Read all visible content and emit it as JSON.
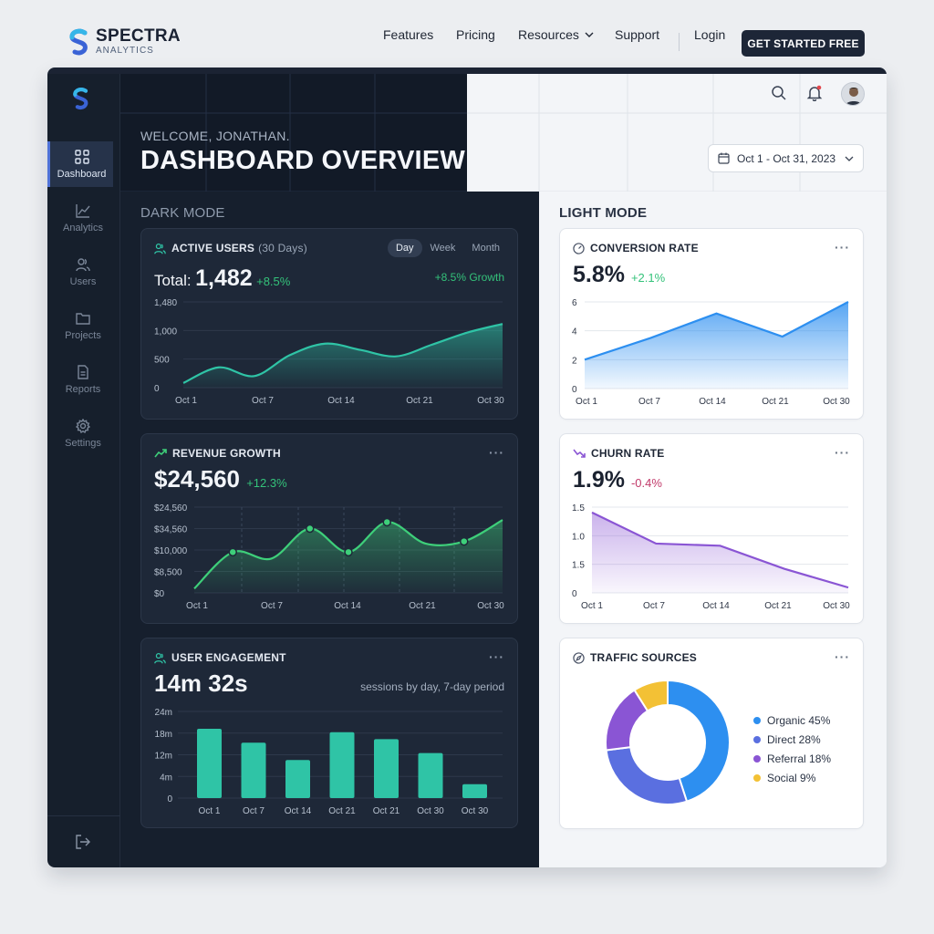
{
  "brand": {
    "name": "SPECTRA",
    "sub": "ANALYTICS"
  },
  "nav": {
    "links": [
      "Features",
      "Pricing",
      "Resources",
      "Support"
    ],
    "login": "Login",
    "cta": "GET STARTED FREE"
  },
  "sidebar": {
    "items": [
      {
        "label": "Dashboard",
        "icon": "grid-icon",
        "active": true
      },
      {
        "label": "Analytics",
        "icon": "trend-icon"
      },
      {
        "label": "Users",
        "icon": "users-icon"
      },
      {
        "label": "Projects",
        "icon": "folder-icon"
      },
      {
        "label": "Reports",
        "icon": "document-icon"
      },
      {
        "label": "Settings",
        "icon": "gear-icon"
      }
    ]
  },
  "header": {
    "welcome": "WELCOME, JONATHAN.",
    "title": "DASHBOARD OVERVIEW",
    "date_range": "Oct 1 - Oct 31, 2023"
  },
  "sections": {
    "dark": "DARK MODE",
    "light": "LIGHT MODE"
  },
  "cards": {
    "active_users": {
      "title": "ACTIVE USERS",
      "subtitle": "(30 Days)",
      "total_label": "Total:",
      "total": "1,482",
      "delta": "+8.5%",
      "growth": "+8.5% Growth",
      "segments": [
        "Day",
        "Week",
        "Month"
      ],
      "selected_segment": "Day"
    },
    "revenue": {
      "title": "REVENUE GROWTH",
      "value": "$24,560",
      "delta": "+12.3%"
    },
    "engagement": {
      "title": "USER ENGAGEMENT",
      "value": "14m 32s",
      "note": "sessions by day, 7-day period"
    },
    "conversion": {
      "title": "CONVERSION RATE",
      "value": "5.8%",
      "delta": "+2.1%"
    },
    "churn": {
      "title": "CHURN RATE",
      "value": "1.9%",
      "delta": "-0.4%"
    },
    "traffic": {
      "title": "TRAFFIC SOURCES"
    }
  },
  "colors": {
    "teal": "#2fc4a6",
    "green": "#3ecf7a",
    "blue": "#2d8ff0",
    "purple": "#8a55d4",
    "indigo": "#5a6fe0",
    "yellow": "#f3c135"
  },
  "chart_data": [
    {
      "id": "active_users",
      "type": "area",
      "x": [
        "Oct 1",
        "Oct 4",
        "Oct 7",
        "Oct 10",
        "Oct 12",
        "Oct 14",
        "Oct 18",
        "Oct 21",
        "Oct 25",
        "Oct 30"
      ],
      "values": [
        80,
        350,
        200,
        560,
        760,
        650,
        540,
        740,
        950,
        1100
      ],
      "yticks": [
        "1,480",
        "1,000",
        "500",
        "0"
      ],
      "ylim": [
        0,
        1480
      ],
      "xticks": [
        "Oct 1",
        "Oct 7",
        "Oct 14",
        "Oct 21",
        "Oct 30"
      ]
    },
    {
      "id": "revenue",
      "type": "area",
      "x": [
        "Oct 1",
        "Oct 5",
        "Oct 7",
        "Oct 10",
        "Oct 14",
        "Oct 18",
        "Oct 21",
        "Oct 25",
        "Oct 30"
      ],
      "values": [
        0.2,
        1.9,
        1.6,
        3.0,
        1.9,
        3.3,
        2.3,
        2.4,
        3.4
      ],
      "markers": [
        1,
        3,
        4,
        5,
        7
      ],
      "yticks": [
        "$24,560",
        "$34,560",
        "$10,000",
        "$8,500",
        "$0"
      ],
      "ylim": [
        0,
        4
      ],
      "xticks": [
        "Oct 1",
        "Oct 7",
        "Oct 14",
        "Oct 21",
        "Oct 30"
      ]
    },
    {
      "id": "engagement",
      "type": "bar",
      "categories": [
        "Oct 1",
        "Oct 7",
        "Oct 14",
        "Oct 21",
        "Oct 21",
        "Oct 30",
        "Oct 30"
      ],
      "values": [
        20,
        16,
        11,
        19,
        17,
        13,
        4
      ],
      "yticks": [
        "24m",
        "18m",
        "12m",
        "4m",
        "0"
      ],
      "ylim": [
        0,
        25
      ]
    },
    {
      "id": "conversion",
      "type": "area",
      "x": [
        "Oct 1",
        "Oct 7",
        "Oct 14",
        "Oct 21",
        "Oct 30"
      ],
      "values": [
        2.0,
        3.5,
        5.2,
        3.6,
        6.0
      ],
      "yticks": [
        "6",
        "4",
        "2",
        "0"
      ],
      "ylim": [
        0,
        6
      ],
      "xticks": [
        "Oct 1",
        "Oct 7",
        "Oct 14",
        "Oct 21",
        "Oct 30"
      ]
    },
    {
      "id": "churn",
      "type": "area",
      "x": [
        "Oct 1",
        "Oct 7",
        "Oct 14",
        "Oct 21",
        "Oct 30"
      ],
      "values": [
        1.5,
        0.92,
        0.88,
        0.45,
        0.1
      ],
      "yticks": [
        "1.5",
        "1.0",
        "1.5",
        "0"
      ],
      "ylim": [
        0,
        1.6
      ],
      "xticks": [
        "Oct 1",
        "Oct 7",
        "Oct 14",
        "Oct 21",
        "Oct 30"
      ]
    },
    {
      "id": "traffic",
      "type": "pie",
      "slices": [
        {
          "label": "Organic 45%",
          "value": 45,
          "color": "#2d8ff0"
        },
        {
          "label": "Direct 28%",
          "value": 28,
          "color": "#5a6fe0"
        },
        {
          "label": "Referral 18%",
          "value": 18,
          "color": "#8a55d4"
        },
        {
          "label": "Social 9%",
          "value": 9,
          "color": "#f3c135"
        }
      ]
    }
  ]
}
